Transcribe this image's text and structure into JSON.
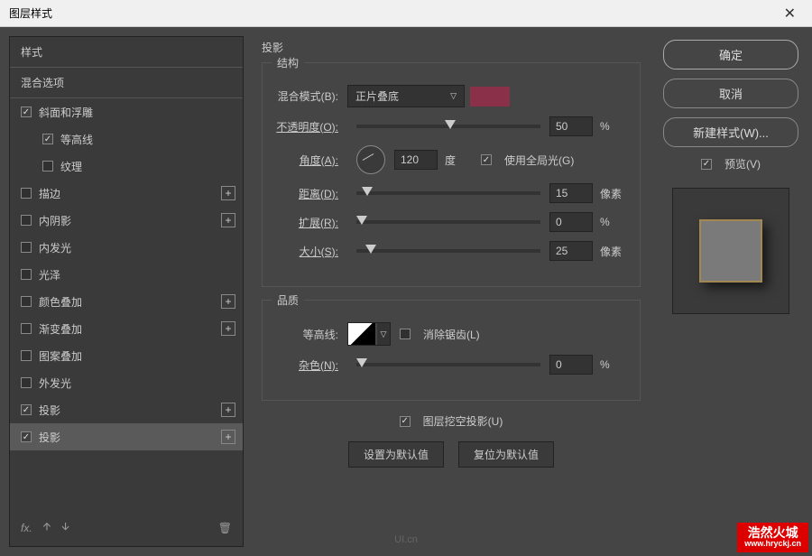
{
  "dialog": {
    "title": "图层样式"
  },
  "styles": {
    "header1": "样式",
    "header2": "混合选项",
    "items": [
      {
        "label": "斜面和浮雕",
        "checked": true,
        "add": false
      },
      {
        "label": "等高线",
        "checked": true,
        "indent": true,
        "add": false
      },
      {
        "label": "纹理",
        "checked": false,
        "indent": true,
        "add": false
      },
      {
        "label": "描边",
        "checked": false,
        "add": true
      },
      {
        "label": "内阴影",
        "checked": false,
        "add": true
      },
      {
        "label": "内发光",
        "checked": false,
        "add": false
      },
      {
        "label": "光泽",
        "checked": false,
        "add": false
      },
      {
        "label": "颜色叠加",
        "checked": false,
        "add": true
      },
      {
        "label": "渐变叠加",
        "checked": false,
        "add": true
      },
      {
        "label": "图案叠加",
        "checked": false,
        "add": false
      },
      {
        "label": "外发光",
        "checked": false,
        "add": false
      },
      {
        "label": "投影",
        "checked": true,
        "add": true
      },
      {
        "label": "投影",
        "checked": true,
        "add": true,
        "selected": true
      }
    ]
  },
  "mid": {
    "title": "投影",
    "structure": {
      "legend": "结构",
      "blendMode": {
        "label": "混合模式(B):",
        "value": "正片叠底",
        "color": "#8a3048"
      },
      "opacity": {
        "label": "不透明度(O):",
        "value": "50",
        "unit": "%"
      },
      "angle": {
        "label": "角度(A):",
        "value": "120",
        "unit": "度",
        "globalLight": "使用全局光(G)",
        "globalChecked": true
      },
      "distance": {
        "label": "距离(D):",
        "value": "15",
        "unit": "像素"
      },
      "spread": {
        "label": "扩展(R):",
        "value": "0",
        "unit": "%"
      },
      "size": {
        "label": "大小(S):",
        "value": "25",
        "unit": "像素"
      }
    },
    "quality": {
      "legend": "品质",
      "contour": {
        "label": "等高线:",
        "antialias": "消除锯齿(L)",
        "antialiasChecked": false
      },
      "noise": {
        "label": "杂色(N):",
        "value": "0",
        "unit": "%"
      }
    },
    "knockout": {
      "label": "图层挖空投影(U)",
      "checked": true
    },
    "defaults": {
      "set": "设置为默认值",
      "reset": "复位为默认值"
    }
  },
  "right": {
    "ok": "确定",
    "cancel": "取消",
    "newStyle": "新建样式(W)...",
    "preview": "预览(V)"
  },
  "watermark": {
    "text": "浩然火城",
    "url": "www.hryckj.cn"
  },
  "uiLogo": "UI.cn"
}
